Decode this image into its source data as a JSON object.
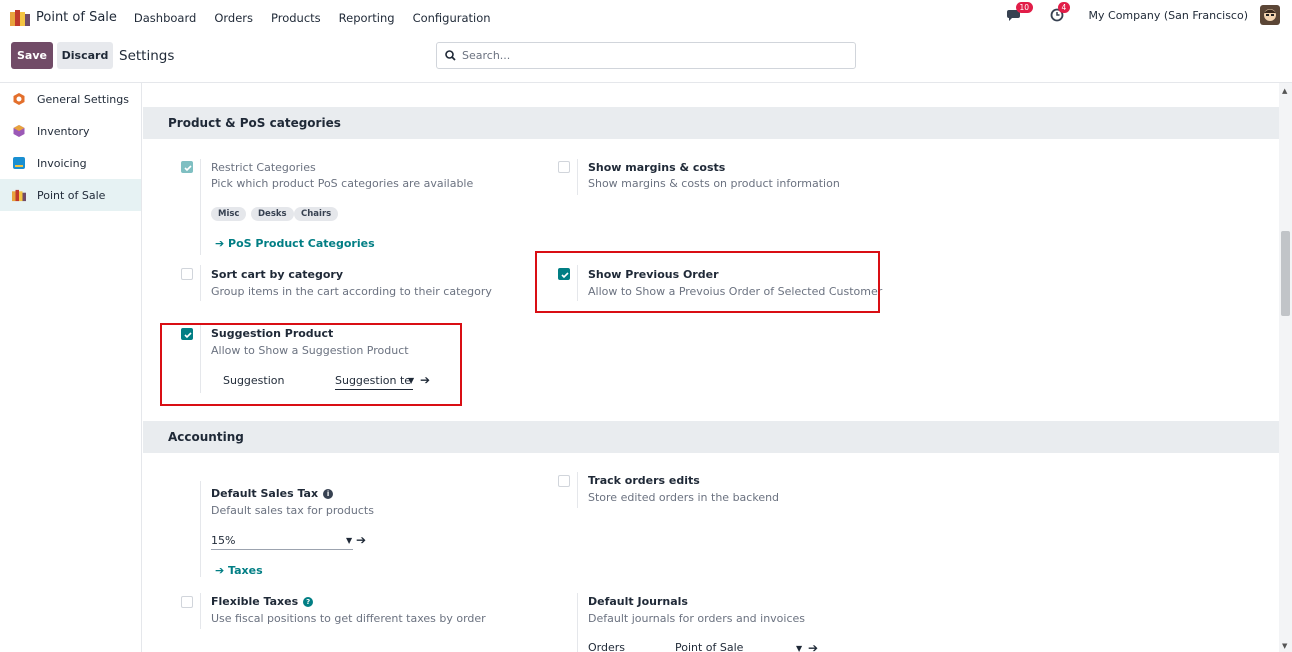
{
  "app": {
    "name": "Point of Sale",
    "icon": "pos-logo-icon"
  },
  "menu": [
    "Dashboard",
    "Orders",
    "Products",
    "Reporting",
    "Configuration"
  ],
  "systray": {
    "messages_count": "10",
    "activities_count": "4",
    "company": "My Company (San Francisco)"
  },
  "control_panel": {
    "save_label": "Save",
    "discard_label": "Discard",
    "title": "Settings",
    "search_placeholder": "Search..."
  },
  "sidebar": {
    "items": [
      {
        "label": "General Settings",
        "icon": "general-settings-icon",
        "active": false
      },
      {
        "label": "Inventory",
        "icon": "inventory-icon",
        "active": false
      },
      {
        "label": "Invoicing",
        "icon": "invoicing-icon",
        "active": false
      },
      {
        "label": "Point of Sale",
        "icon": "pos-icon",
        "active": true
      }
    ]
  },
  "sections": {
    "product_categories": {
      "title": "Product & PoS categories",
      "restrict": {
        "title": "Restrict Categories",
        "desc": "Pick which product PoS categories are available",
        "checked": true,
        "tags": [
          "Misc",
          "Desks",
          "Chairs"
        ],
        "link": "PoS Product Categories"
      },
      "margins": {
        "title": "Show margins & costs",
        "desc": "Show margins & costs on product information",
        "checked": false
      },
      "sort_cart": {
        "title": "Sort cart by category",
        "desc": "Group items in the cart according to their category",
        "checked": false
      },
      "previous_order": {
        "title": "Show Previous Order",
        "desc": "Allow to Show a Prevoius Order of Selected Customer",
        "checked": true
      },
      "suggestion": {
        "title": "Suggestion Product",
        "desc": "Allow to Show a Suggestion Product",
        "checked": true,
        "field_label": "Suggestion",
        "field_value": "Suggestion te"
      }
    },
    "accounting": {
      "title": "Accounting",
      "default_tax": {
        "title": "Default Sales Tax",
        "desc": "Default sales tax for products",
        "value": "15%",
        "link": "Taxes"
      },
      "track_edits": {
        "title": "Track orders edits",
        "desc": "Store edited orders in the backend",
        "checked": false
      },
      "flexible_taxes": {
        "title": "Flexible Taxes",
        "desc": "Use fiscal positions to get different taxes by order",
        "checked": false
      },
      "default_journals": {
        "title": "Default Journals",
        "desc": "Default journals for orders and invoices",
        "orders_label": "Orders",
        "orders_value": "Point of Sale"
      }
    }
  },
  "colors": {
    "primary": "#714b67",
    "accent": "#017e84",
    "highlight": "#d90e14",
    "badge": "#e11d48"
  }
}
